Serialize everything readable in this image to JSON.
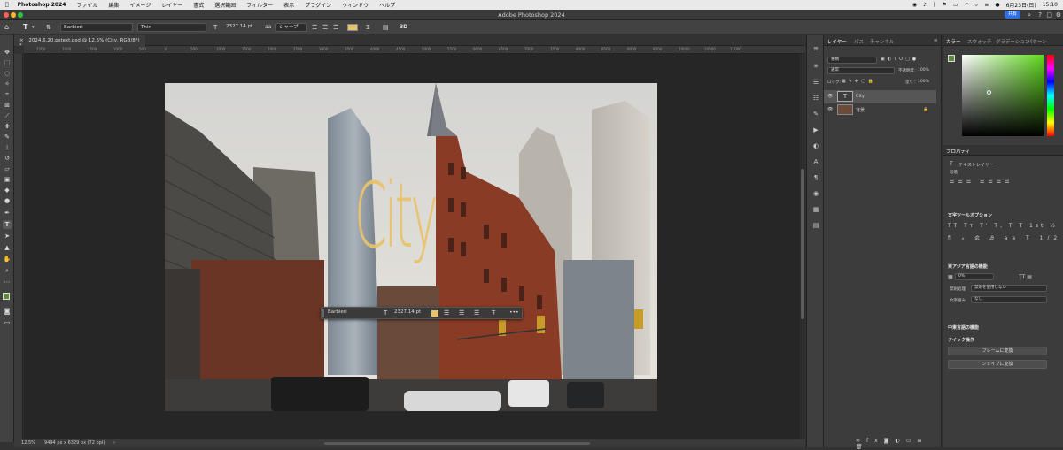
{
  "menubar": {
    "app_name": "Photoshop 2024",
    "items": [
      "ファイル",
      "編集",
      "イメージ",
      "レイヤー",
      "書式",
      "選択範囲",
      "フィルター",
      "表示",
      "プラグイン",
      "ウィンドウ",
      "ヘルプ"
    ],
    "date": "6月23日(日)",
    "time": "15:10"
  },
  "window": {
    "title": "Adobe Photoshop 2024",
    "share_label": "共有"
  },
  "options_bar": {
    "font_family": "Barbieri",
    "font_style": "Thin",
    "font_size": "2327.14 pt",
    "antialias": "シャープ",
    "color_swatch": "#e9c36b",
    "threed_label": "3D"
  },
  "document": {
    "tab_label": "2024.6.20.pstext.psd @ 12.5% (City, RGB/8*) *",
    "ruler_ticks": [
      "2200",
      "2000",
      "1500",
      "1000",
      "500",
      "0",
      "500",
      "1000",
      "1500",
      "2000",
      "2500",
      "3000",
      "3500",
      "4000",
      "4500",
      "5000",
      "5500",
      "6000",
      "6500",
      "7000",
      "7500",
      "8000",
      "8500",
      "9000",
      "9500",
      "10000",
      "10500",
      "11000"
    ],
    "city_text": "City",
    "status_zoom": "12.5%",
    "status_info": "9494 px x 6329 px (72 ppi)"
  },
  "contextual_bar": {
    "font_family": "Barbieri",
    "font_size": "2327.14 pt",
    "more": "•••"
  },
  "layers_panel": {
    "tabs": [
      "レイヤー",
      "パス",
      "チャンネル"
    ],
    "filter_label": "種類",
    "blend_mode": "通常",
    "opacity_label": "不透明度：",
    "opacity_value": "100%",
    "lock_label": "ロック：",
    "fill_label": "塗り：",
    "fill_value": "100%",
    "layers": [
      {
        "name": "City",
        "type": "text",
        "selected": true
      },
      {
        "name": "背景",
        "type": "image",
        "selected": false
      }
    ]
  },
  "color_panel": {
    "tabs": [
      "カラー",
      "スウォッチ",
      "グラデーション",
      "パターン"
    ],
    "foreground": "#5e8a3c",
    "hue_color": "#5fd81c"
  },
  "properties_panel": {
    "title": "プロパティ",
    "layer_type": "テキストレイヤー",
    "paragraph_label": "段落",
    "char_options_title": "文字ツールオプション",
    "east_asian_title": "東アジア言語の機能",
    "tsume_value": "0%",
    "kinsoku_label": "禁則処理",
    "kinsoku_value": "禁則を使用しない",
    "mojikumi_label": "文字組み",
    "mojikumi_value": "なし",
    "middle_east_title": "中東言語の機能",
    "quick_actions_title": "クイック操作",
    "convert_frame_label": "フレームに変換",
    "convert_shape_label": "シェイプに変換"
  }
}
